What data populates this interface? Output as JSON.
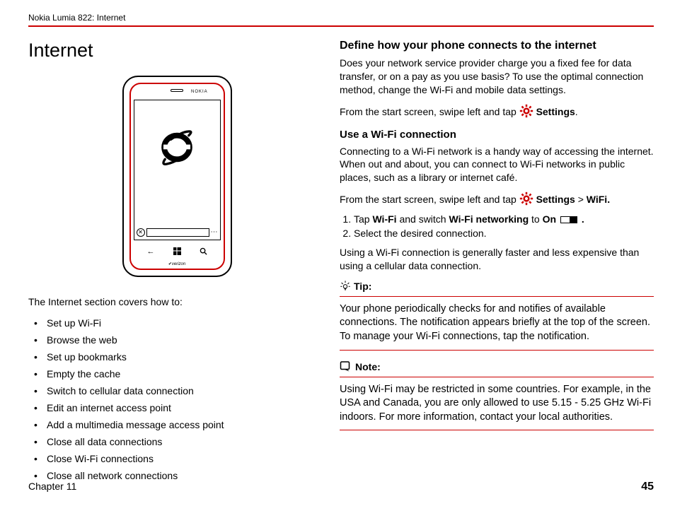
{
  "header": {
    "title": "Nokia Lumia 822: Internet"
  },
  "left": {
    "title": "Internet",
    "phone_brand": "NOKIA",
    "carrier": "verizon",
    "intro": "The Internet section covers how to:",
    "covers": [
      "Set up Wi-Fi",
      "Browse the web",
      "Set up bookmarks",
      "Empty the cache",
      "Switch to cellular data connection",
      "Edit an internet access point",
      "Add a multimedia message access point",
      "Close all data connections",
      "Close Wi-Fi connections",
      "Close all network connections"
    ]
  },
  "right": {
    "h1": "Define how your phone connects to the internet",
    "p1": "Does your network service provider charge you a fixed fee for data transfer, or on a pay as you use basis? To use the optimal connection method, change the Wi-Fi and mobile data settings.",
    "p2_prefix": "From the start screen, swipe left and tap ",
    "settings_label": "Settings",
    "h2": "Use a Wi-Fi connection",
    "p3": "Connecting to a Wi-Fi network is a handy way of accessing the internet. When out and about, you can connect to Wi-Fi networks in public places, such as a library or internet café.",
    "p4_prefix": "From the start screen, swipe left and tap  ",
    "p4_gt": " > ",
    "wifi_label": "WiFi.",
    "step1_a": "Tap ",
    "step1_b": "Wi-Fi",
    "step1_c": " and switch ",
    "step1_d": "Wi-Fi networking",
    "step1_e": " to ",
    "step1_f": "On",
    "step1_g": " .",
    "step2": "Select the desired connection.",
    "p5": "Using a Wi-Fi connection is generally faster and less expensive than using a cellular data  connection.",
    "tip_label": "Tip:",
    "tip_body": "Your phone periodically checks for and notifies of available connections. The notification appears briefly at the top of the screen. To manage your Wi-Fi connections, tap the notification.",
    "note_label": "Note:",
    "note_body": "Using Wi-Fi may be restricted in some countries. For example, in the USA and Canada, you are only allowed to use 5.15 - 5.25 GHz Wi-Fi indoors. For more information, contact your local authorities."
  },
  "footer": {
    "chapter": "Chapter 11",
    "page": "45"
  }
}
